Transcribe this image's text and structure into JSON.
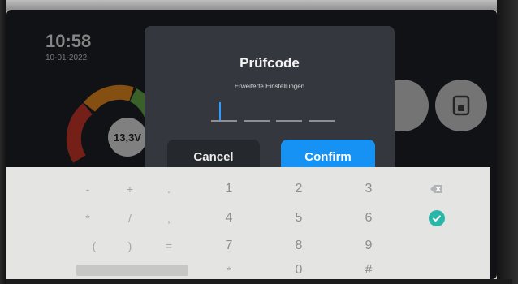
{
  "status": {
    "time": "10:58",
    "date": "10-01-2022"
  },
  "battery_gauge": {
    "voltage": "13,3V",
    "colors": [
      "#d33a2c",
      "#f0901e",
      "#6ab04c"
    ]
  },
  "home_buttons": [
    {
      "icon": "circle-button-icon"
    },
    {
      "icon": "door-lock-icon"
    }
  ],
  "dialog": {
    "title": "Prüfcode",
    "subtitle": "Erweiterte Einstellungen",
    "pin_length": 4,
    "cancel_label": "Cancel",
    "confirm_label": "Confirm",
    "accent": "#1592f4"
  },
  "keyboard": {
    "rows": [
      [
        "-",
        "+",
        ".",
        "1",
        "2",
        "3",
        "backspace"
      ],
      [
        "*",
        "/",
        ",",
        "4",
        "5",
        "6",
        "done"
      ],
      [
        "(",
        ")",
        "=",
        "7",
        "8",
        "9",
        ""
      ],
      [
        "space",
        "",
        "",
        "*",
        "0",
        "#",
        ""
      ]
    ],
    "done_color": "#2ab6a8"
  }
}
